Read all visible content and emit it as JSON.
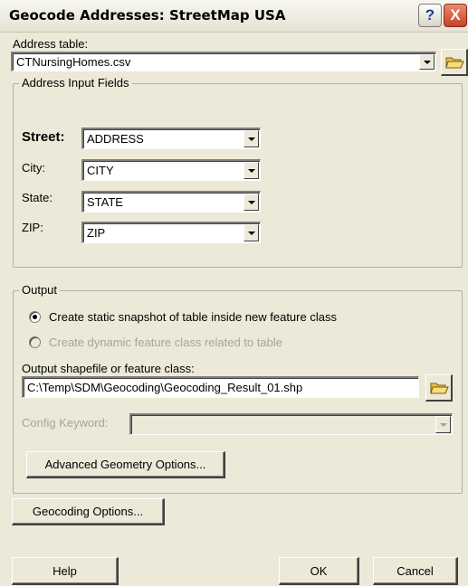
{
  "window": {
    "title": "Geocode Addresses: StreetMap USA"
  },
  "address_table": {
    "label": "Address table:",
    "value": "CTNursingHomes.csv"
  },
  "address_input": {
    "group_title": "Address Input Fields",
    "fields": [
      {
        "label": "Street:",
        "value": "ADDRESS"
      },
      {
        "label": "City:",
        "value": "CITY"
      },
      {
        "label": "State:",
        "value": "STATE"
      },
      {
        "label": "ZIP:",
        "value": "ZIP"
      }
    ]
  },
  "output": {
    "group_title": "Output",
    "radio_static": {
      "label": "Create static snapshot of table inside new feature class",
      "checked": true
    },
    "radio_dynamic": {
      "label": "Create dynamic feature class related to table",
      "enabled": false
    },
    "shapefile_label": "Output shapefile or feature class:",
    "shapefile_value": "C:\\Temp\\SDM\\Geocoding\\Geocoding_Result_01.shp",
    "config_keyword_label": "Config Keyword:",
    "config_keyword_value": "",
    "advanced_button": "Advanced Geometry Options..."
  },
  "geocoding_options_button": "Geocoding Options...",
  "footer": {
    "help": "Help",
    "ok": "OK",
    "cancel": "Cancel"
  },
  "icons": {
    "help": "?",
    "close": "X",
    "folder": "open-folder-icon"
  }
}
